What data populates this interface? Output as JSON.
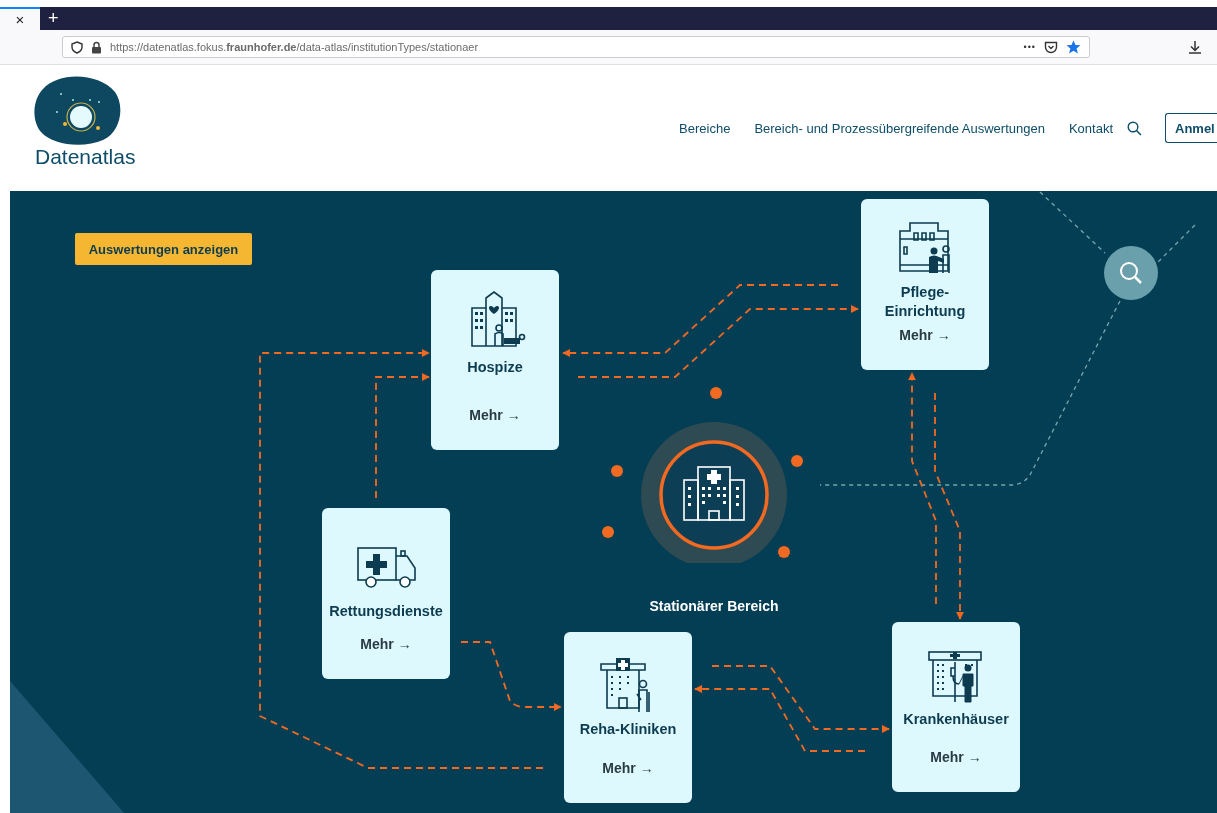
{
  "browser": {
    "tab_close": "×",
    "new_tab": "+",
    "url": "https://datenatlas.fokus.**fraunhofer.de**/data-atlas/institutionTypes/stationaer",
    "page_actions": "•••"
  },
  "header": {
    "logo_text": "Datenatlas",
    "nav": [
      "Bereiche",
      "Bereich- und Prozessübergreifende Auswertungen",
      "Kontakt"
    ],
    "login_button": "Anmel"
  },
  "diagram": {
    "action_button": "Auswertungen anzeigen",
    "hub_label": "Stationärer Bereich",
    "cards": [
      {
        "kind": "hospice",
        "title": "Hospize",
        "link": "Mehr →"
      },
      {
        "kind": "nursing",
        "title": "Pflege-Einrichtung",
        "link": "Mehr →"
      },
      {
        "kind": "ambulance",
        "title": "Rettungsdienste",
        "link": "Mehr →"
      },
      {
        "kind": "rehab",
        "title": "Reha-Kliniken",
        "link": "Mehr →"
      },
      {
        "kind": "hospital",
        "title": "Krankenhäuser",
        "link": "Mehr →"
      }
    ]
  }
}
